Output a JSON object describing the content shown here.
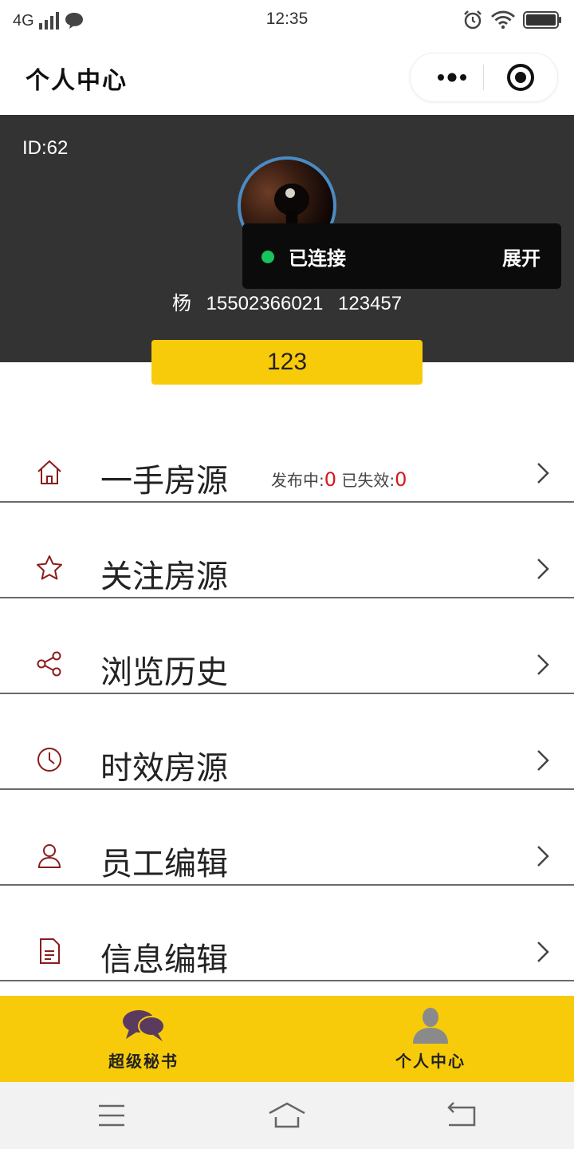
{
  "status_bar": {
    "network": "4G",
    "time": "12:35"
  },
  "nav": {
    "title": "个人中心",
    "more_icon": "more-dots-icon",
    "close_icon": "target-circle-icon"
  },
  "header": {
    "id_text": "ID:62",
    "user_name": "杨",
    "phone": "15502366021",
    "code": "123457",
    "value_bar": "123",
    "colors": {
      "background": "#333333",
      "avatar_border": "#4a8bc4",
      "value_bar": "#f8cb0a"
    }
  },
  "toast": {
    "status": "已连接",
    "expand": "展开",
    "status_color": "#18c35a"
  },
  "menu": {
    "items": [
      {
        "label": "一手房源",
        "icon": "home-icon",
        "stats": {
          "publishing_label": "发布中:",
          "publishing_value": "0",
          "expired_label": "已失效:",
          "expired_value": "0"
        }
      },
      {
        "label": "关注房源",
        "icon": "star-icon"
      },
      {
        "label": "浏览历史",
        "icon": "share-nodes-icon"
      },
      {
        "label": "时效房源",
        "icon": "clock-icon"
      },
      {
        "label": "员工编辑",
        "icon": "person-icon"
      },
      {
        "label": "信息编辑",
        "icon": "document-icon"
      }
    ]
  },
  "tabbar": {
    "tabs": [
      {
        "label": "超级秘书",
        "icon": "chat-bubbles-icon"
      },
      {
        "label": "个人中心",
        "icon": "user-silhouette-icon",
        "active": true
      }
    ],
    "background": "#f8cb0a"
  },
  "system_nav": {
    "buttons": [
      "menu-lines-icon",
      "home-outline-icon",
      "back-arrow-icon"
    ]
  }
}
